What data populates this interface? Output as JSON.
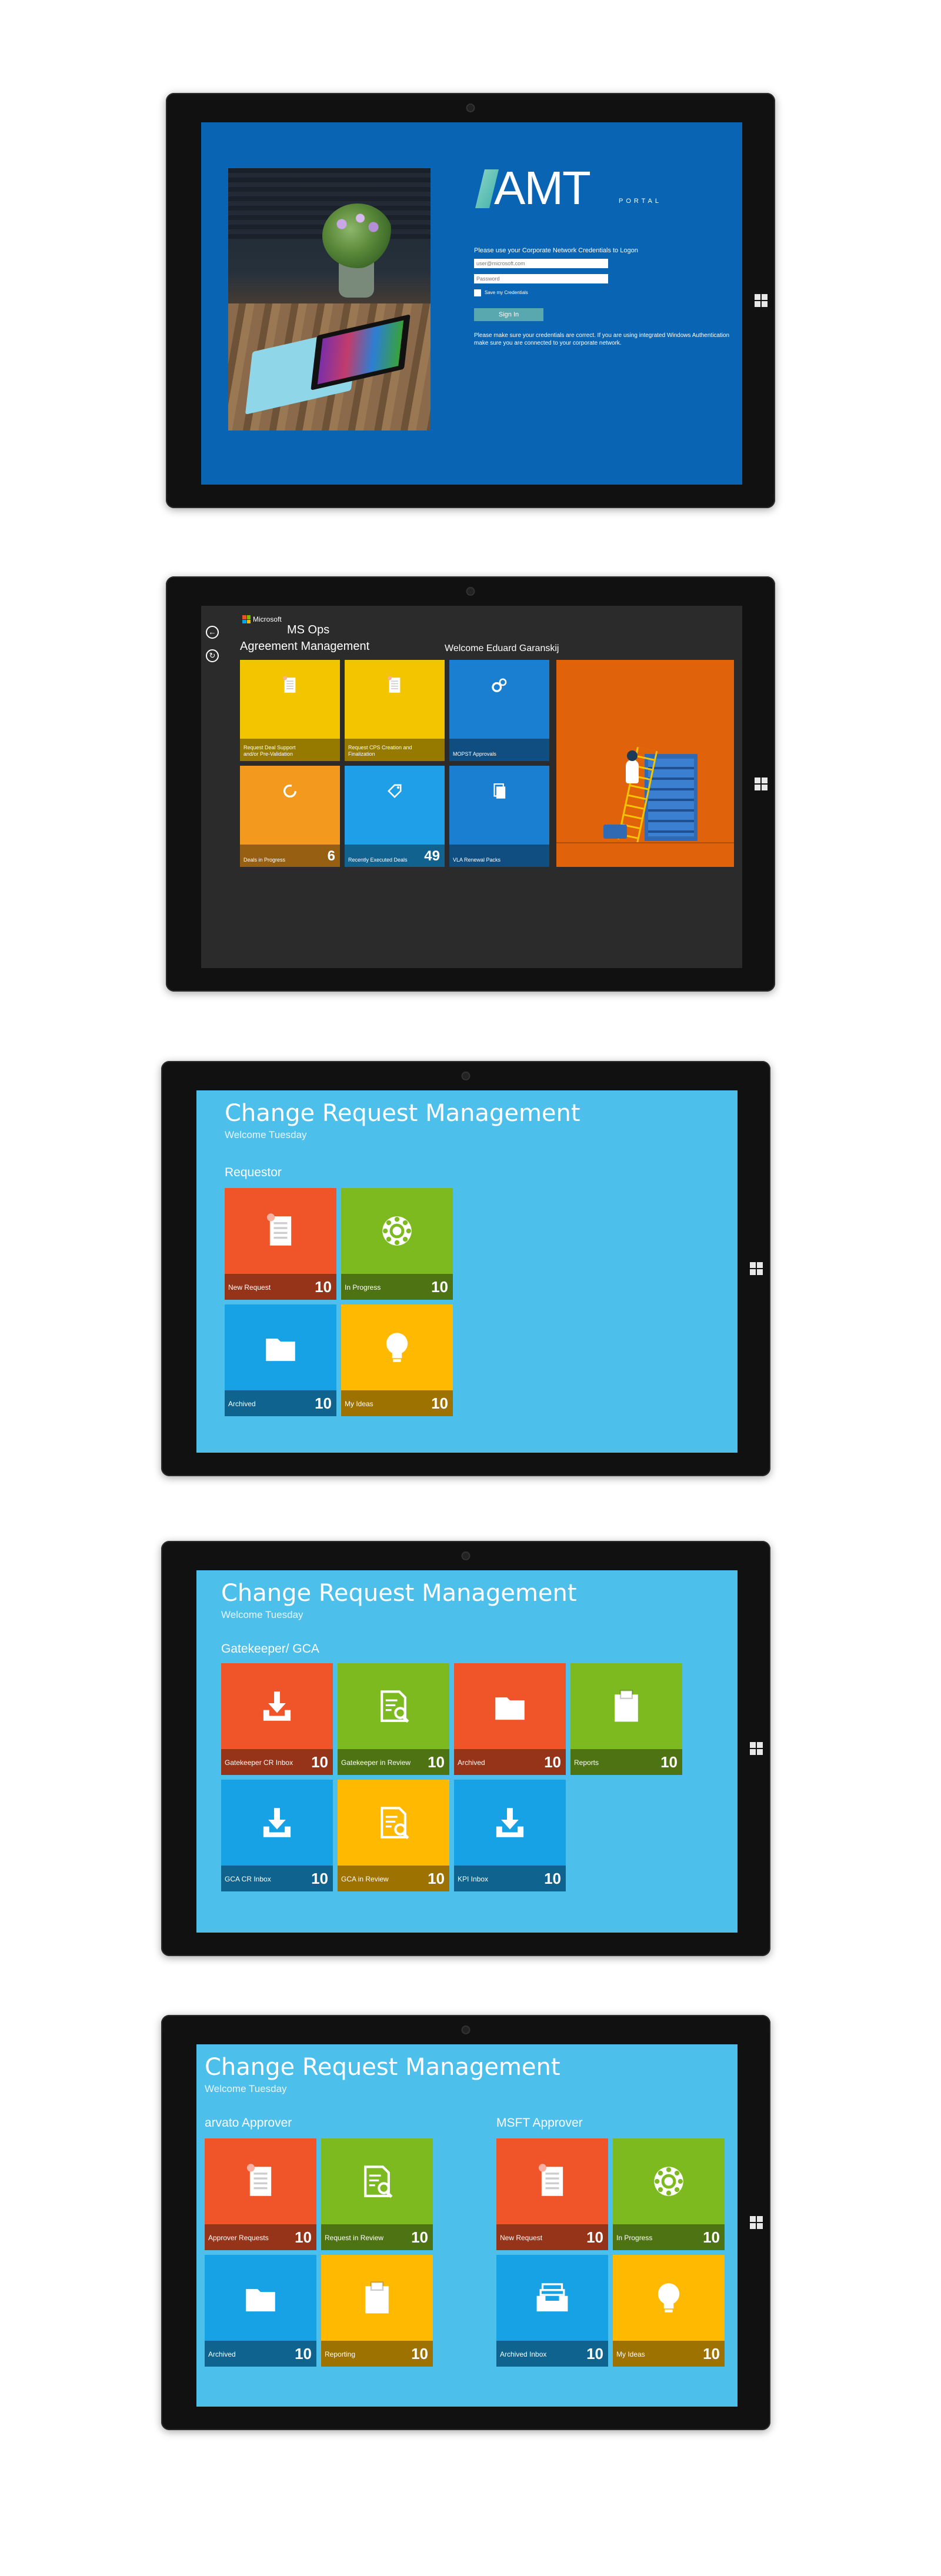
{
  "login": {
    "logo_text": "AMT",
    "logo_sub": "PORTAL",
    "instruction": "Please use your Corporate Network Credentials to Logon",
    "email_placeholder": "user@microsoft.com",
    "password_placeholder": "Password",
    "save_label": "Save my Credentials",
    "signin_label": "Sign In",
    "note": "Please make sure your credentials are correct. If you are using integrated Windows Authentication make sure you are connected to your corporate network."
  },
  "msops": {
    "brand": "Microsoft",
    "app": "MS Ops",
    "section": "Agreement Management",
    "welcome": "Welcome Eduard Garanskij",
    "tiles": [
      {
        "label": "Request Deal Support and/or Pre-Validation",
        "count": "",
        "icon": "document-icon",
        "color": "#f2c500"
      },
      {
        "label": "Request CPS Creation and Finalization",
        "count": "",
        "icon": "document-icon",
        "color": "#f2c500"
      },
      {
        "label": "MOPST Approvals",
        "count": "",
        "icon": "gears-icon",
        "color": "#1a7fd0"
      },
      {
        "label": "Deals in Progress",
        "count": "6",
        "icon": "spinner-icon",
        "color": "#f39a1e"
      },
      {
        "label": "Recently Executed Deals",
        "count": "49",
        "icon": "tag-icon",
        "color": "#1e9fe8"
      },
      {
        "label": "VLA Renewal Packs",
        "count": "",
        "icon": "copy-icon",
        "color": "#1a7fd0"
      }
    ]
  },
  "crm_title": "Change Request Management",
  "crm_welcome": "Welcome Tuesday",
  "requestor": {
    "section": "Requestor",
    "tiles": [
      {
        "label": "New Request",
        "count": "10",
        "icon": "document-icon",
        "color": "#f05529"
      },
      {
        "label": "In Progress",
        "count": "10",
        "icon": "gear-icon",
        "color": "#7cba1f"
      },
      {
        "label": "Archived",
        "count": "10",
        "icon": "folder-icon",
        "color": "#17a2e6"
      },
      {
        "label": "My Ideas",
        "count": "10",
        "icon": "lightbulb-icon",
        "color": "#ffb900"
      }
    ]
  },
  "gatekeeper": {
    "section": "Gatekeeper/ GCA",
    "tiles": [
      {
        "label": "Gatekeeper CR Inbox",
        "count": "10",
        "icon": "download-icon",
        "color": "#f05529"
      },
      {
        "label": "Gatekeeper in Review",
        "count": "10",
        "icon": "review-icon",
        "color": "#7cba1f"
      },
      {
        "label": "Archived",
        "count": "10",
        "icon": "folder-icon",
        "color": "#f05529"
      },
      {
        "label": "Reports",
        "count": "10",
        "icon": "clipboard-icon",
        "color": "#7cba1f"
      },
      {
        "label": "GCA CR Inbox",
        "count": "10",
        "icon": "download-icon",
        "color": "#17a2e6"
      },
      {
        "label": "GCA in Review",
        "count": "10",
        "icon": "review-icon",
        "color": "#ffb900"
      },
      {
        "label": "KPI Inbox",
        "count": "10",
        "icon": "download-icon",
        "color": "#17a2e6"
      }
    ]
  },
  "arvato": {
    "section": "arvato Approver",
    "tiles": [
      {
        "label": "Approver Requests",
        "count": "10",
        "icon": "document-icon",
        "color": "#f05529"
      },
      {
        "label": "Request in Review",
        "count": "10",
        "icon": "review-icon",
        "color": "#7cba1f"
      },
      {
        "label": "Archived",
        "count": "10",
        "icon": "folder-icon",
        "color": "#17a2e6"
      },
      {
        "label": "Reporting",
        "count": "10",
        "icon": "clipboard-icon",
        "color": "#ffb900"
      }
    ]
  },
  "msft": {
    "section": "MSFT Approver",
    "tiles": [
      {
        "label": "New Request",
        "count": "10",
        "icon": "document-icon",
        "color": "#f05529"
      },
      {
        "label": "In Progress",
        "count": "10",
        "icon": "gear-icon",
        "color": "#7cba1f"
      },
      {
        "label": "Archived Inbox",
        "count": "10",
        "icon": "inbox-icon",
        "color": "#17a2e6"
      },
      {
        "label": "My Ideas",
        "count": "10",
        "icon": "lightbulb-icon",
        "color": "#ffb900"
      }
    ]
  },
  "colors": {
    "login_bg": "#0a64b4",
    "msops_bg": "#2b2b2b",
    "crm_bg": "#4cbfea",
    "hero_orange": "#e0620b"
  }
}
